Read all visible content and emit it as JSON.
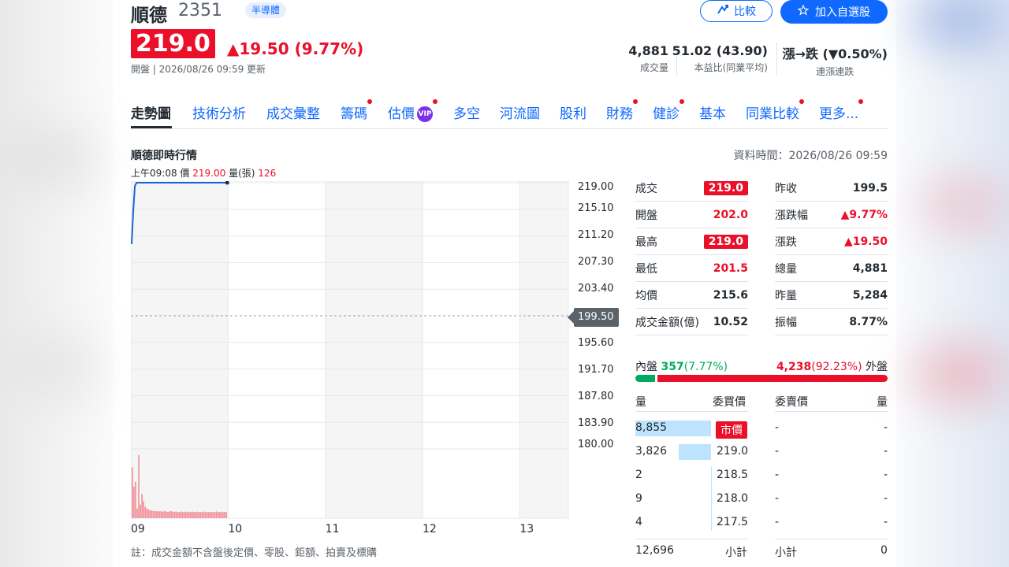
{
  "header": {
    "name": "順德",
    "code": "2351",
    "industry_tag": "半導體",
    "compare_label": "比較",
    "watchlist_label": "加入自選股",
    "price": "219.0",
    "change": "▲19.50 (9.77%)",
    "subline": "開盤 | 2026/08/26 09:59 更新"
  },
  "key_stats": [
    {
      "value": "4,881",
      "label": "成交量"
    },
    {
      "value": "51.02 (43.90)",
      "label": "本益比(同業平均)"
    },
    {
      "value": "漲→跌 (▼0.50%)",
      "label": "連漲連跌"
    }
  ],
  "tabs": [
    {
      "label": "走勢圖",
      "dot": false
    },
    {
      "label": "技術分析",
      "dot": false
    },
    {
      "label": "成交彙整",
      "dot": false
    },
    {
      "label": "籌碼",
      "dot": true
    },
    {
      "label": "估價",
      "dot": true,
      "badge": "VIP"
    },
    {
      "label": "多空",
      "dot": false
    },
    {
      "label": "河流圖",
      "dot": false
    },
    {
      "label": "股利",
      "dot": false
    },
    {
      "label": "財務",
      "dot": true
    },
    {
      "label": "健診",
      "dot": true
    },
    {
      "label": "基本",
      "dot": false
    },
    {
      "label": "同業比較",
      "dot": true
    },
    {
      "label": "更多...",
      "dot": true
    }
  ],
  "section": {
    "title": "順德即時行情",
    "data_time": "資料時間：2026/08/26 09:59",
    "cursor_time": "上午09:08",
    "cursor_price_label": "價",
    "cursor_price": "219.00",
    "cursor_vol_label": "量(張)",
    "cursor_vol": "126",
    "note": "註：成交金額不含盤後定價、零股、鉅額、拍賣及標購"
  },
  "chart_data": {
    "type": "line",
    "y_ticks": [
      "219.00",
      "215.10",
      "211.20",
      "207.30",
      "203.40",
      "199.50",
      "195.60",
      "191.70",
      "187.80",
      "183.90",
      "180.00"
    ],
    "x_ticks": [
      "09",
      "10",
      "11",
      "12",
      "13"
    ],
    "reference_price": "199.50",
    "ylim": [
      180.0,
      219.0
    ],
    "price_series": {
      "minutes_from_open": [
        0,
        1,
        2,
        3,
        8,
        20,
        40,
        59
      ],
      "price": [
        210.0,
        215.0,
        218.5,
        219.0,
        219.0,
        219.0,
        219.0,
        219.0
      ]
    },
    "volume_series": {
      "values": [
        420,
        260,
        300,
        80,
        520,
        110,
        200,
        140,
        95,
        80,
        70,
        65,
        62,
        60,
        58,
        60,
        55,
        58,
        56,
        55,
        60,
        55,
        52,
        55,
        58,
        55,
        52,
        55,
        50,
        52,
        55,
        50,
        52,
        55,
        50,
        52,
        50,
        55,
        52,
        50,
        53,
        50,
        52,
        50,
        55,
        50,
        52,
        50,
        53,
        50,
        52,
        50,
        55,
        52,
        50,
        53,
        50,
        52,
        50
      ]
    },
    "colors": {
      "line": "#1b65d6",
      "volume": "#f1919a",
      "session_shade": "#f5f5f5"
    }
  },
  "quote_left": [
    {
      "label": "成交",
      "value": "219.0",
      "boxed": true
    },
    {
      "label": "開盤",
      "value": "202.0",
      "boxed": false,
      "color": "red"
    },
    {
      "label": "最高",
      "value": "219.0",
      "boxed": true
    },
    {
      "label": "最低",
      "value": "201.5",
      "boxed": false,
      "color": "red"
    },
    {
      "label": "均價",
      "value": "215.6",
      "boxed": false,
      "color": "dark"
    },
    {
      "label": "成交金額(億)",
      "value": "10.52",
      "boxed": false,
      "color": "dark"
    }
  ],
  "quote_right": [
    {
      "label": "昨收",
      "value": "199.5",
      "color": "dark"
    },
    {
      "label": "漲跌幅",
      "value": "▲9.77%",
      "color": "red"
    },
    {
      "label": "漲跌",
      "value": "▲19.50",
      "color": "red"
    },
    {
      "label": "總量",
      "value": "4,881",
      "color": "dark"
    },
    {
      "label": "昨量",
      "value": "5,284",
      "color": "dark"
    },
    {
      "label": "振幅",
      "value": "8.77%",
      "color": "dark"
    }
  ],
  "inner_outer": {
    "inner_label": "內盤",
    "inner_value": "357",
    "inner_pct": "(7.77%)",
    "outer_value": "4,238",
    "outer_pct": "(92.23%)",
    "outer_label": "外盤",
    "inner_fraction": 0.0777
  },
  "order_book": {
    "headers": [
      "量",
      "委買價",
      "委賣價",
      "量"
    ],
    "rows": [
      {
        "bid_vol": "8,855",
        "bid_price": "市價",
        "market": true,
        "ask_price": "-",
        "ask_vol": "-",
        "bar_fraction": 1.0
      },
      {
        "bid_vol": "3,826",
        "bid_price": "219.0",
        "market": false,
        "ask_price": "-",
        "ask_vol": "-",
        "bar_fraction": 0.43
      },
      {
        "bid_vol": "2",
        "bid_price": "218.5",
        "market": false,
        "ask_price": "-",
        "ask_vol": "-",
        "bar_fraction": 0.0
      },
      {
        "bid_vol": "9",
        "bid_price": "218.0",
        "market": false,
        "ask_price": "-",
        "ask_vol": "-",
        "bar_fraction": 0.0
      },
      {
        "bid_vol": "4",
        "bid_price": "217.5",
        "market": false,
        "ask_price": "-",
        "ask_vol": "-",
        "bar_fraction": 0.0
      }
    ],
    "bid_total": "12,696",
    "bid_total_label": "小計",
    "ask_total_label": "小計",
    "ask_total": "0"
  }
}
